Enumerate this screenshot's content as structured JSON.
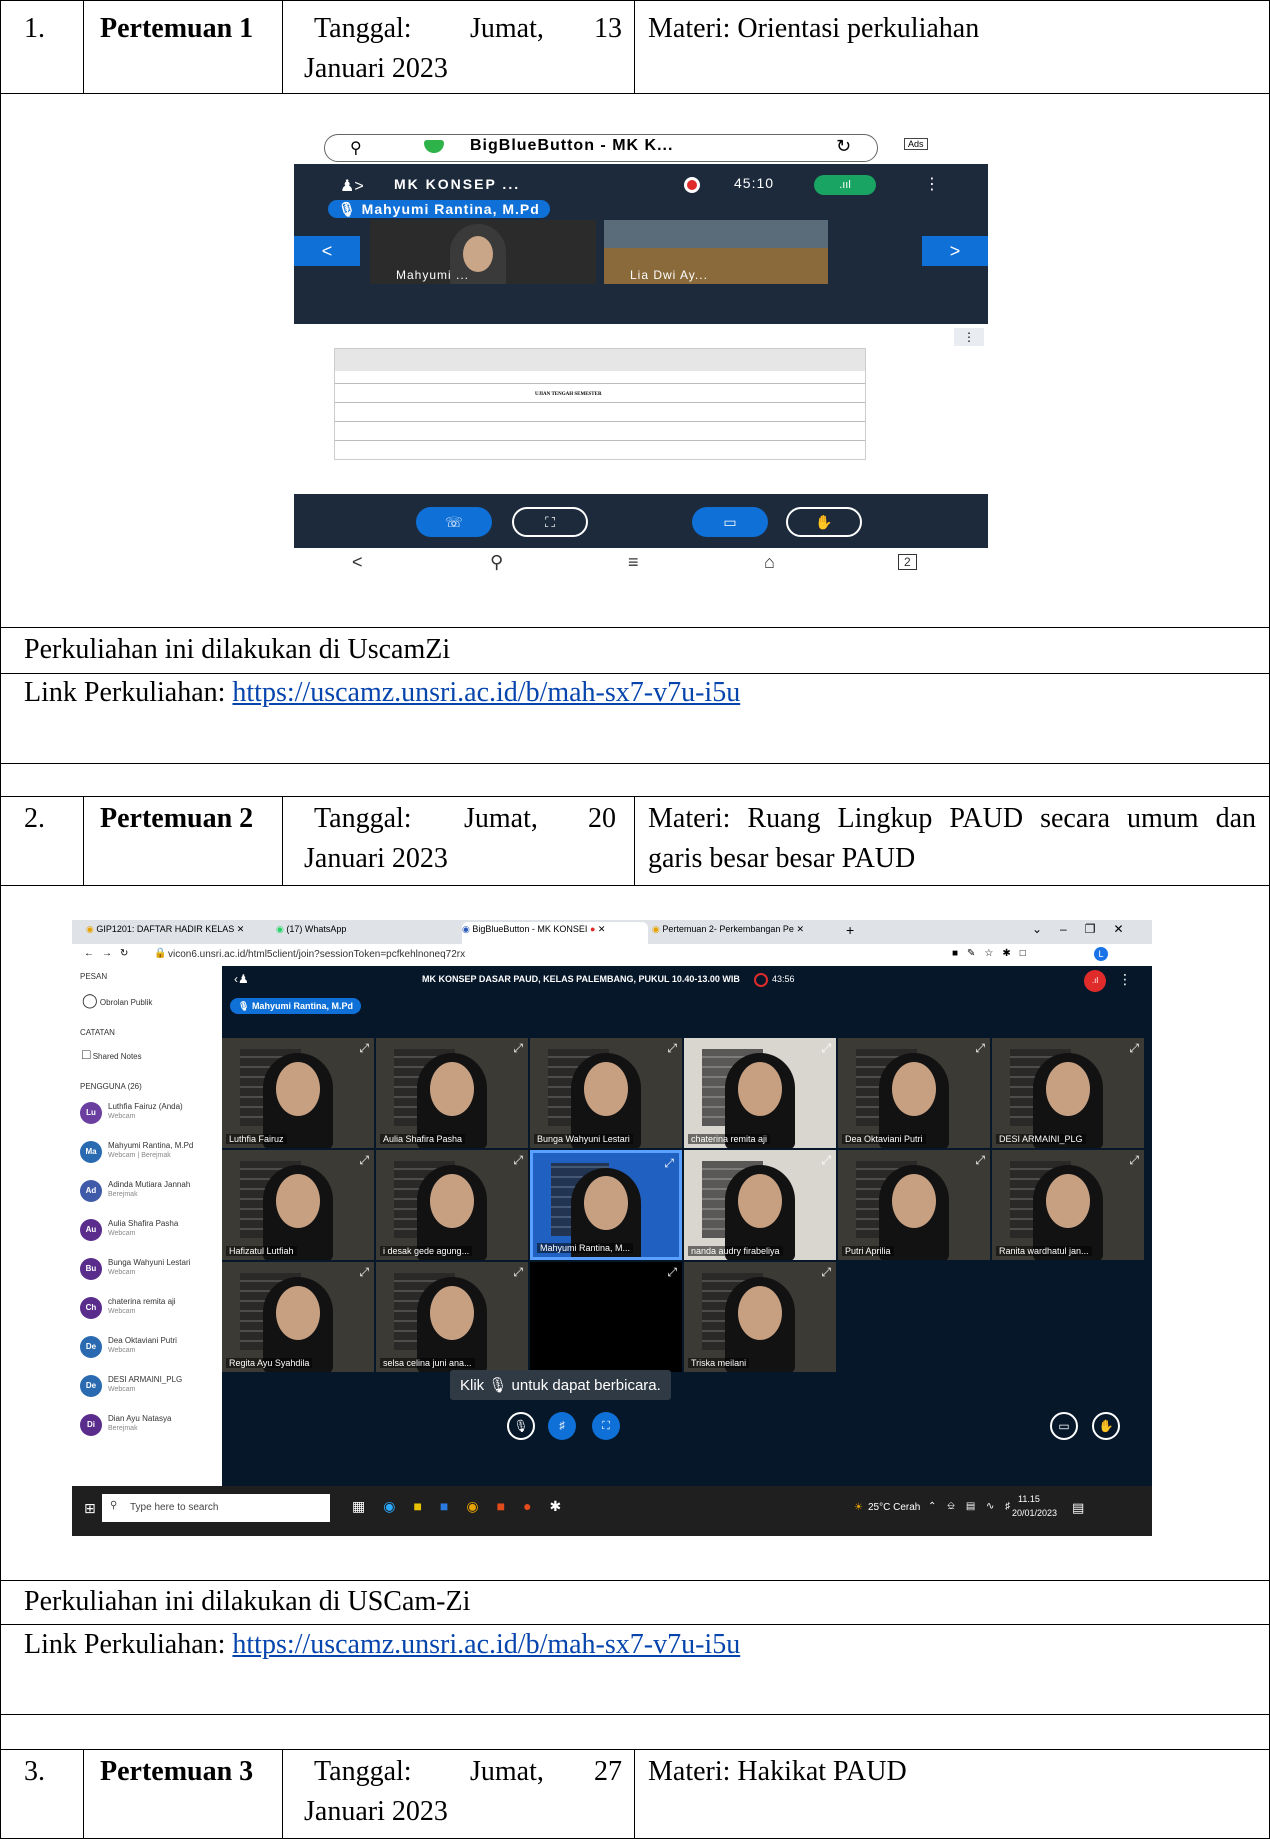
{
  "meetings": [
    {
      "no": "1.",
      "title": "Pertemuan 1",
      "tanggal_label": "Tanggal:",
      "tanggal_day": "Jumat,",
      "tanggal_date": "13",
      "tanggal_month": "Januari 2023",
      "materi": "Materi: Orientasi perkuliahan"
    },
    {
      "no": "2.",
      "title": "Pertemuan 2",
      "tanggal_label": "Tanggal:",
      "tanggal_day": "Jumat,",
      "tanggal_date": "20",
      "tanggal_month": "Januari 2023",
      "materi_line1": "Materi: Ruang Lingkup PAUD secara umum dan",
      "materi_line2": "garis besar besar PAUD"
    },
    {
      "no": "3.",
      "title": "Pertemuan 3",
      "tanggal_label": "Tanggal:",
      "tanggal_day": "Jumat,",
      "tanggal_date": "27",
      "tanggal_month": "Januari 2023",
      "materi": "Materi: Hakikat PAUD"
    }
  ],
  "sections": [
    {
      "place": "Perkuliahan ini dilakukan di UscamZi",
      "link_label": "Link Perkuliahan:",
      "link": "https://uscamz.unsri.ac.id/b/mah-sx7-v7u-i5u"
    },
    {
      "place": "Perkuliahan ini dilakukan di USCam-Zi",
      "link_label": "Link Perkuliahan:",
      "link": "https://uscamz.unsri.ac.id/b/mah-sx7-v7u-i5u"
    }
  ],
  "shot1": {
    "app_title": "BigBlueButton - MK K...",
    "session": "MK KONSEP ...",
    "timer": "45:10",
    "presenter": "Mahyumi Rantina, M.Pd",
    "tile1": "Mahyumi ...",
    "tile2": "Lia Dwi Ay...",
    "table_midterm": "UJIAN TENGAH SEMESTER"
  },
  "shot2": {
    "tabs": [
      "GIP1201: DAFTAR HADIR KELAS",
      "(17) WhatsApp",
      "BigBlueButton - MK KONSEI",
      "Pertemuan 2- Perkembangan Pe"
    ],
    "url": "vicon6.unsri.ac.id/html5client/join?sessionToken=pcfkehlnoneq72rx",
    "pesan": "PESAN",
    "obrolan": "Obrolan Publik",
    "catatan": "CATATAN",
    "shared": "Shared Notes",
    "pengguna": "PENGGUNA (26)",
    "users": [
      {
        "init": "Lu",
        "name": "Luthfia Fairuz (Anda)",
        "sub": "Webcam",
        "color": "#6b3fa0"
      },
      {
        "init": "Ma",
        "name": "Mahyumi Rantina, M.Pd",
        "sub": "Webcam | Berejmak",
        "color": "#2a6ab0"
      },
      {
        "init": "Ad",
        "name": "Adinda Mutiara Jannah",
        "sub": "Berejmak",
        "color": "#3f5aa8"
      },
      {
        "init": "Au",
        "name": "Aulia Shafira Pasha",
        "sub": "Webcam",
        "color": "#5a2d8c"
      },
      {
        "init": "Bu",
        "name": "Bunga Wahyuni Lestari",
        "sub": "Webcam",
        "color": "#5a2d8c"
      },
      {
        "init": "Ch",
        "name": "chaterina remita aji",
        "sub": "Webcam",
        "color": "#5a2d8c"
      },
      {
        "init": "De",
        "name": "Dea Oktaviani Putri",
        "sub": "Webcam",
        "color": "#2a6ab0"
      },
      {
        "init": "De",
        "name": "DESI ARMAINI_PLG",
        "sub": "Webcam",
        "color": "#2a6ab0"
      },
      {
        "init": "Di",
        "name": "Dian Ayu Natasya",
        "sub": "Berejmak",
        "color": "#5a2d8c"
      }
    ],
    "meeting_title": "MK KONSEP DASAR PAUD, KELAS PALEMBANG, PUKUL 10.40-13.00 WIB",
    "timer": "43:56",
    "presenter": "Mahyumi Rantina, M.Pd",
    "tiles": [
      "Luthfia Fairuz",
      "Aulia Shafira Pasha",
      "Bunga Wahyuni Lestari",
      "chaterina remita aji",
      "Dea Oktaviani Putri",
      "DESI ARMAINI_PLG",
      "Hafizatul Lutfiah",
      "i desak gede agung...",
      "Mahyumi Rantina, M...",
      "nanda audry firabeliya",
      "Putri Aprilia",
      "Ranita wardhatul jan...",
      "Regita Ayu Syahdila",
      "selsa celina juni ana...",
      "",
      "Triska meilani"
    ],
    "tooltip": "Klik 🎙 untuk dapat berbicara.",
    "search": "Type here to search",
    "weather": "25°C Cerah",
    "clock_time": "11.15",
    "clock_date": "20/01/2023"
  }
}
